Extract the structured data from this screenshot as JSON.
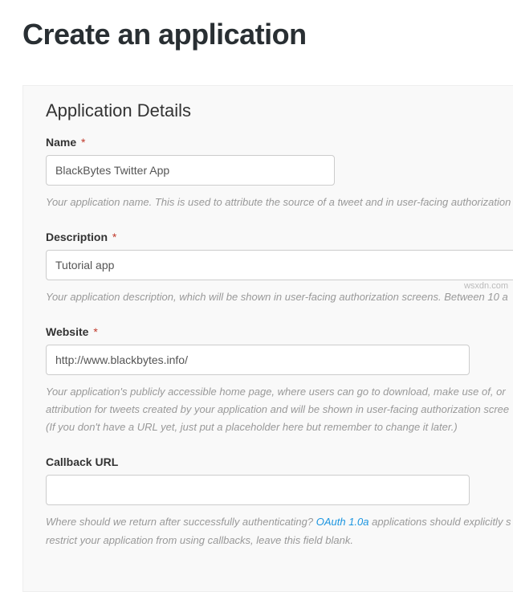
{
  "page": {
    "title": "Create an application"
  },
  "panel": {
    "section_title": "Application Details"
  },
  "form": {
    "name": {
      "label": "Name",
      "required": "*",
      "value": "BlackBytes Twitter App",
      "help": "Your application name. This is used to attribute the source of a tweet and in user-facing authorization"
    },
    "description": {
      "label": "Description",
      "required": "*",
      "value": "Tutorial app",
      "help": "Your application description, which will be shown in user-facing authorization screens. Between 10 a"
    },
    "website": {
      "label": "Website",
      "required": "*",
      "value": "http://www.blackbytes.info/",
      "help_line1": "Your application's publicly accessible home page, where users can go to download, make use of, or",
      "help_line2": "attribution for tweets created by your application and will be shown in user-facing authorization scree",
      "help_line3": "(If you don't have a URL yet, just put a placeholder here but remember to change it later.)"
    },
    "callback": {
      "label": "Callback URL",
      "value": "",
      "help_pre": "Where should we return after successfully authenticating? ",
      "help_link": "OAuth 1.0a",
      "help_post": " applications should explicitly s",
      "help_line2": "restrict your application from using callbacks, leave this field blank."
    }
  },
  "watermark": "wsxdn.com"
}
